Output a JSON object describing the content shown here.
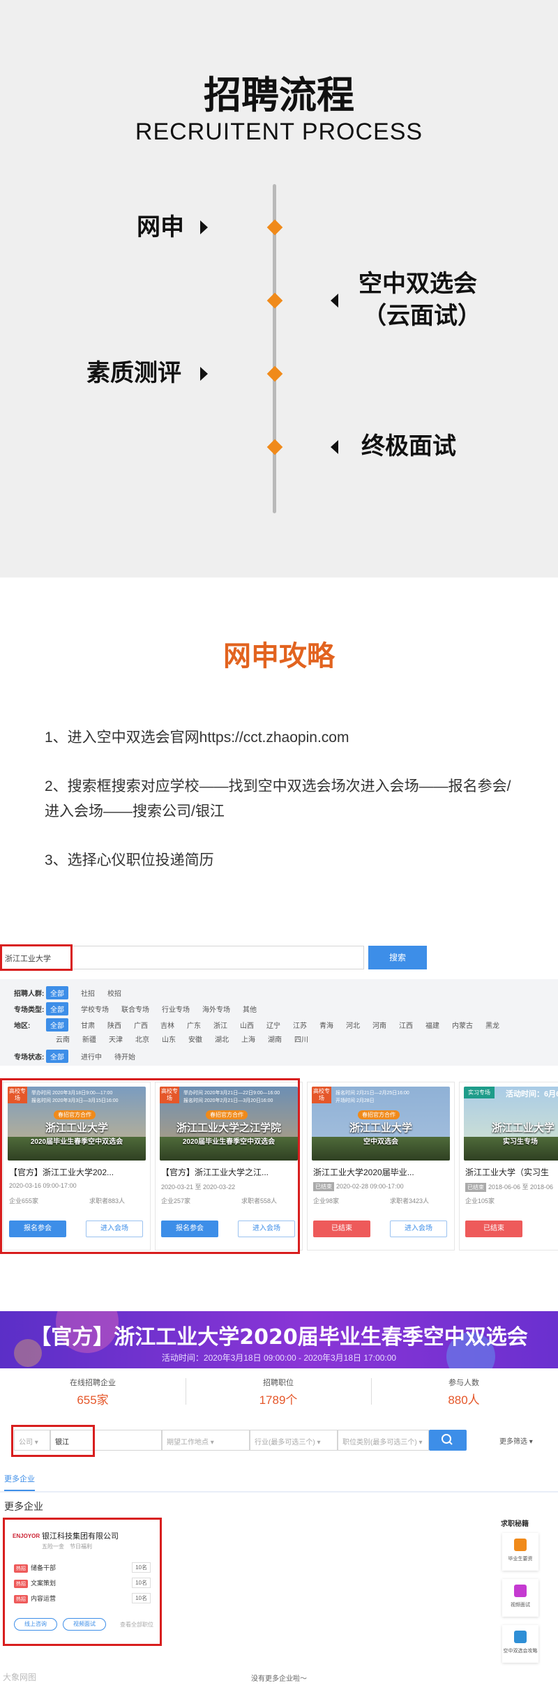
{
  "process": {
    "title": "招聘流程",
    "subtitle": "RECRUITENT PROCESS",
    "steps": [
      "网申",
      "空中双选会",
      "（云面试）",
      "素质测评",
      "终极面试"
    ]
  },
  "guide": {
    "title": "网申攻略",
    "lines": [
      "1、进入空中双选会官网https://cct.zhaopin.com",
      "2、搜索框搜索对应学校——找到空中双选会场次进入会场——报名参会/进入会场——搜索公司/银江",
      "3、选择心仪职位投递简历"
    ]
  },
  "search": {
    "value": "浙江工业大学",
    "button": "搜索"
  },
  "filters": {
    "audience": {
      "label": "招聘人群:",
      "options": [
        "全部",
        "社招",
        "校招"
      ]
    },
    "type": {
      "label": "专场类型:",
      "options": [
        "全部",
        "学校专场",
        "联合专场",
        "行业专场",
        "海外专场",
        "其他"
      ]
    },
    "region": {
      "label": "地区:",
      "row1": [
        "全部",
        "甘肃",
        "陕西",
        "广西",
        "吉林",
        "广东",
        "浙江",
        "山西",
        "辽宁",
        "江苏",
        "青海",
        "河北",
        "河南",
        "江西",
        "福建",
        "内蒙古",
        "黑龙"
      ],
      "row2": [
        "云南",
        "新疆",
        "天津",
        "北京",
        "山东",
        "安徽",
        "湖北",
        "上海",
        "湖南",
        "四川"
      ]
    },
    "status": {
      "label": "专场状态:",
      "options": [
        "全部",
        "进行中",
        "待开始"
      ]
    }
  },
  "cards": [
    {
      "tag": "高校专场",
      "meta1": "举办时间 2020年3月18日9:00—17:00",
      "meta2": "报名时间 2020年3月3日—3月15日16:00",
      "pill": "春招官方合作",
      "img_title": "浙江工业大学",
      "img_sub": "2020届毕业生春季空中双选会",
      "name": "【官方】浙江工业大学202...",
      "date": "2020-03-16 09:00-17:00",
      "companies": "企业655家",
      "seekers": "求职者883人",
      "btn1": "报名参会",
      "btn2": "进入会场"
    },
    {
      "tag": "高校专场",
      "meta1": "举办时间 2020年3月21日—22日9:00—16:00",
      "meta2": "报名时间 2020年2月21日—3月20日16:00",
      "pill": "春招官方合作",
      "img_title": "浙江工业大学之江学院",
      "img_sub": "2020届毕业生春季空中双选会",
      "name": "【官方】浙江工业大学之江...",
      "date": "2020-03-21 至 2020-03-22",
      "companies": "企业257家",
      "seekers": "求职者558人",
      "btn1": "报名参会",
      "btn2": "进入会场"
    },
    {
      "tag": "高校专场",
      "meta1": "报名时间 2月21日—2月25日16:00",
      "meta2": "开场时间 2月28日",
      "pill": "春招官方合作",
      "img_title": "浙江工业大学",
      "img_sub": "空中双选会",
      "name": "浙江工业大学2020届毕业...",
      "ended": "已结束",
      "date": "2020-02-28 09:00-17:00",
      "companies": "企业98家",
      "seekers": "求职者3423人",
      "btn1": "已结束",
      "btn2": "进入会场"
    },
    {
      "tag": "实习专场",
      "meta1": "活动时间：6月6",
      "img_title": "浙江工业大学",
      "img_sub": "实习生专场",
      "name": "浙江工业大学（实习生",
      "ended": "已结束",
      "date": "2018-06-06 至 2018-06",
      "companies": "企业105家",
      "btn1": "已结束"
    }
  ],
  "fair": {
    "title": "【官方】浙江工业大学2020届毕业生春季空中双选会",
    "time": "活动时间：2020年3月18日 09:00:00 - 2020年3月18日 17:00:00",
    "stats": [
      {
        "label": "在线招聘企业",
        "value": "655家"
      },
      {
        "label": "招聘职位",
        "value": "1789个"
      },
      {
        "label": "参与人数",
        "value": "880人"
      }
    ],
    "query": {
      "type": "公司",
      "value": "银江",
      "location": "期望工作地点",
      "industry": "行业(最多可选三个)",
      "category": "职位类别(最多可选三个)",
      "more": "更多筛选"
    },
    "tab": "更多企业",
    "section": "更多企业",
    "company": {
      "logo": "ENJOYOR",
      "name": "银江科技集团有限公司",
      "meta": "五险一金　节日福利",
      "jobs": [
        {
          "tag": "热招",
          "title": "储备干部",
          "count": "10名"
        },
        {
          "tag": "热招",
          "title": "文案策划",
          "count": "10名"
        },
        {
          "tag": "热招",
          "title": "内容运营",
          "count": "10名"
        }
      ],
      "btn1": "线上咨询",
      "btn2": "视频面试",
      "link": "查看全部职位"
    },
    "side": {
      "title": "求职秘籍",
      "items": [
        "毕业生要资",
        "视频面试",
        "空中双选会攻略"
      ]
    },
    "more": "没有更多企业啦～"
  },
  "watermark": "大象网图"
}
